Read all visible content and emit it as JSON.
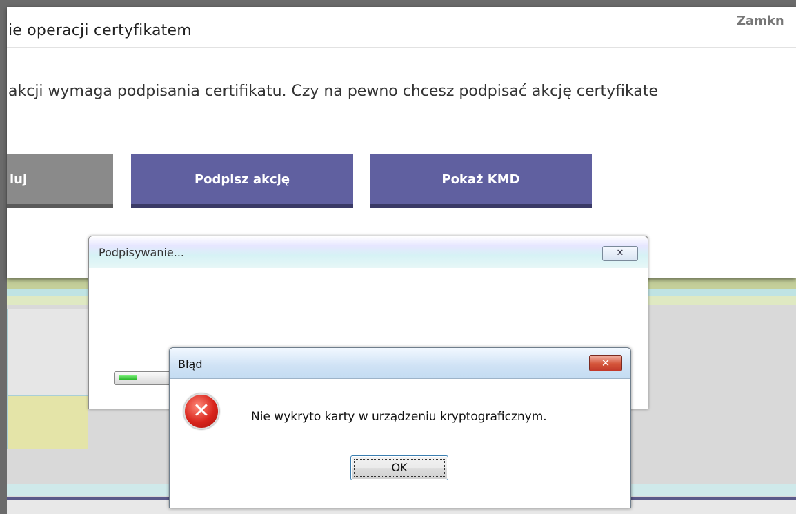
{
  "modal": {
    "title": "ie operacji certyfikatem",
    "close_label": "Zamkn",
    "message": "akcji wymaga podpisania certifikatu. Czy na pewno chcesz podpisać akcję certyfikate",
    "buttons": {
      "cancel_label": "luj",
      "sign_label": "Podpisz akcję",
      "kmd_label": "Pokaż KMD"
    }
  },
  "signing_dialog": {
    "title": "Podpisywanie...",
    "close_icon": "close-icon",
    "progress_fraction": 0.35
  },
  "error_dialog": {
    "title": "Błąd",
    "icon": "error-icon",
    "message": "Nie wykryto karty w urządzeniu kryptograficznym.",
    "ok_label": "OK"
  }
}
